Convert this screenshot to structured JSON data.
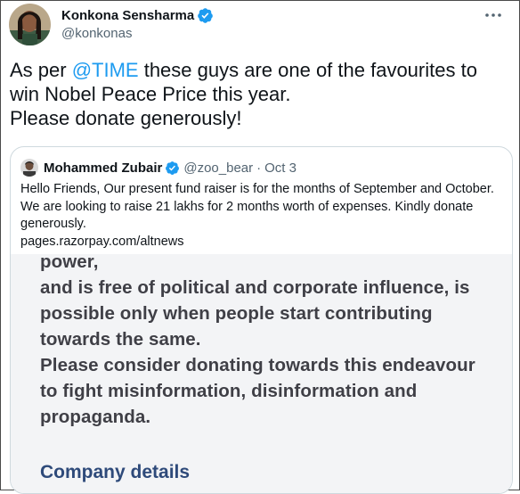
{
  "tweet": {
    "author_name": "Konkona Sensharma",
    "author_handle": "@konkonas",
    "text_before_mention": "As per ",
    "mention": "@TIME",
    "text_line1_after": " these guys are one of the favourites to",
    "text_line2": "win Nobel Peace Price this year.",
    "text_line3": "Please donate generously!"
  },
  "quote": {
    "author_name": "Mohammed Zubair",
    "author_handle": "@zoo_bear",
    "separator": "·",
    "date": "Oct 3",
    "text": "Hello Friends, Our present fund raiser is for the months of September and October. We are looking to raise 21 lakhs for 2 months worth of expenses. Kindly donate generously.",
    "link": "pages.razorpay.com/altnews",
    "image_lines": [
      "power,",
      "and is free of political and corporate influence, is",
      "possible only when people start contributing",
      "towards the same.",
      "Please consider donating towards this endeavour",
      "to fight misinformation, disinformation and",
      "propaganda."
    ],
    "image_heading": "Company details"
  },
  "colors": {
    "link": "#1d9bf0",
    "verified": "#1d9bf0",
    "secondary_text": "#536471",
    "image_heading": "#2e4a7a"
  },
  "icons": {
    "verified": "verified-badge-icon",
    "more": "more-options-icon"
  }
}
